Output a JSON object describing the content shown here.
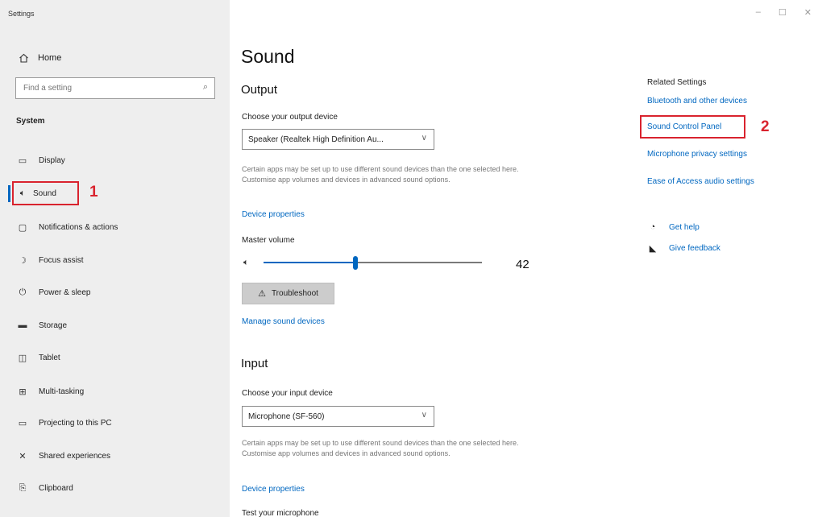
{
  "window": {
    "title": "Settings",
    "controls": [
      "–",
      "☐",
      "✕"
    ]
  },
  "sidebar": {
    "home_label": "Home",
    "search_placeholder": "Find a setting",
    "section_header": "System",
    "items": [
      {
        "label": "Display",
        "icon": "display-icon"
      },
      {
        "label": "Sound",
        "icon": "speaker-icon",
        "active": true
      },
      {
        "label": "Notifications & actions",
        "icon": "notification-icon"
      },
      {
        "label": "Focus assist",
        "icon": "moon-icon"
      },
      {
        "label": "Power & sleep",
        "icon": "power-icon"
      },
      {
        "label": "Storage",
        "icon": "storage-icon"
      },
      {
        "label": "Tablet",
        "icon": "tablet-icon"
      },
      {
        "label": "Multi-tasking",
        "icon": "multitasking-icon"
      },
      {
        "label": "Projecting to this PC",
        "icon": "projecting-icon"
      },
      {
        "label": "Shared experiences",
        "icon": "shared-experiences-icon"
      },
      {
        "label": "Clipboard",
        "icon": "clipboard-icon"
      }
    ]
  },
  "annotations": {
    "marker_1": "1",
    "marker_2": "2",
    "color": "#d9232e"
  },
  "main": {
    "page_title": "Sound",
    "output": {
      "heading": "Output",
      "choose_label": "Choose your output device",
      "device_value": "Speaker (Realtek High Definition Au...",
      "description": "Certain apps may be set up to use different sound devices than the one selected here. Customise app volumes and devices in advanced sound options.",
      "device_properties_link": "Device properties",
      "master_volume_label": "Master volume",
      "volume_value": "42",
      "volume_fraction": 0.42,
      "troubleshoot_label": "Troubleshoot",
      "manage_link": "Manage sound devices"
    },
    "input": {
      "heading": "Input",
      "choose_label": "Choose your input device",
      "device_value": "Microphone (SF-560)",
      "description": "Certain apps may be set up to use different sound devices than the one selected here. Customise app volumes and devices in advanced sound options.",
      "device_properties_link": "Device properties",
      "test_label": "Test your microphone"
    }
  },
  "related": {
    "header": "Related Settings",
    "links": [
      "Bluetooth and other devices",
      "Sound Control Panel",
      "Microphone privacy settings",
      "Ease of Access audio settings"
    ],
    "get_help": "Get help",
    "give_feedback": "Give feedback"
  },
  "colors": {
    "accent": "#0067c0",
    "sidebar_bg": "#eeeeee",
    "button_bg": "#cccccc"
  }
}
